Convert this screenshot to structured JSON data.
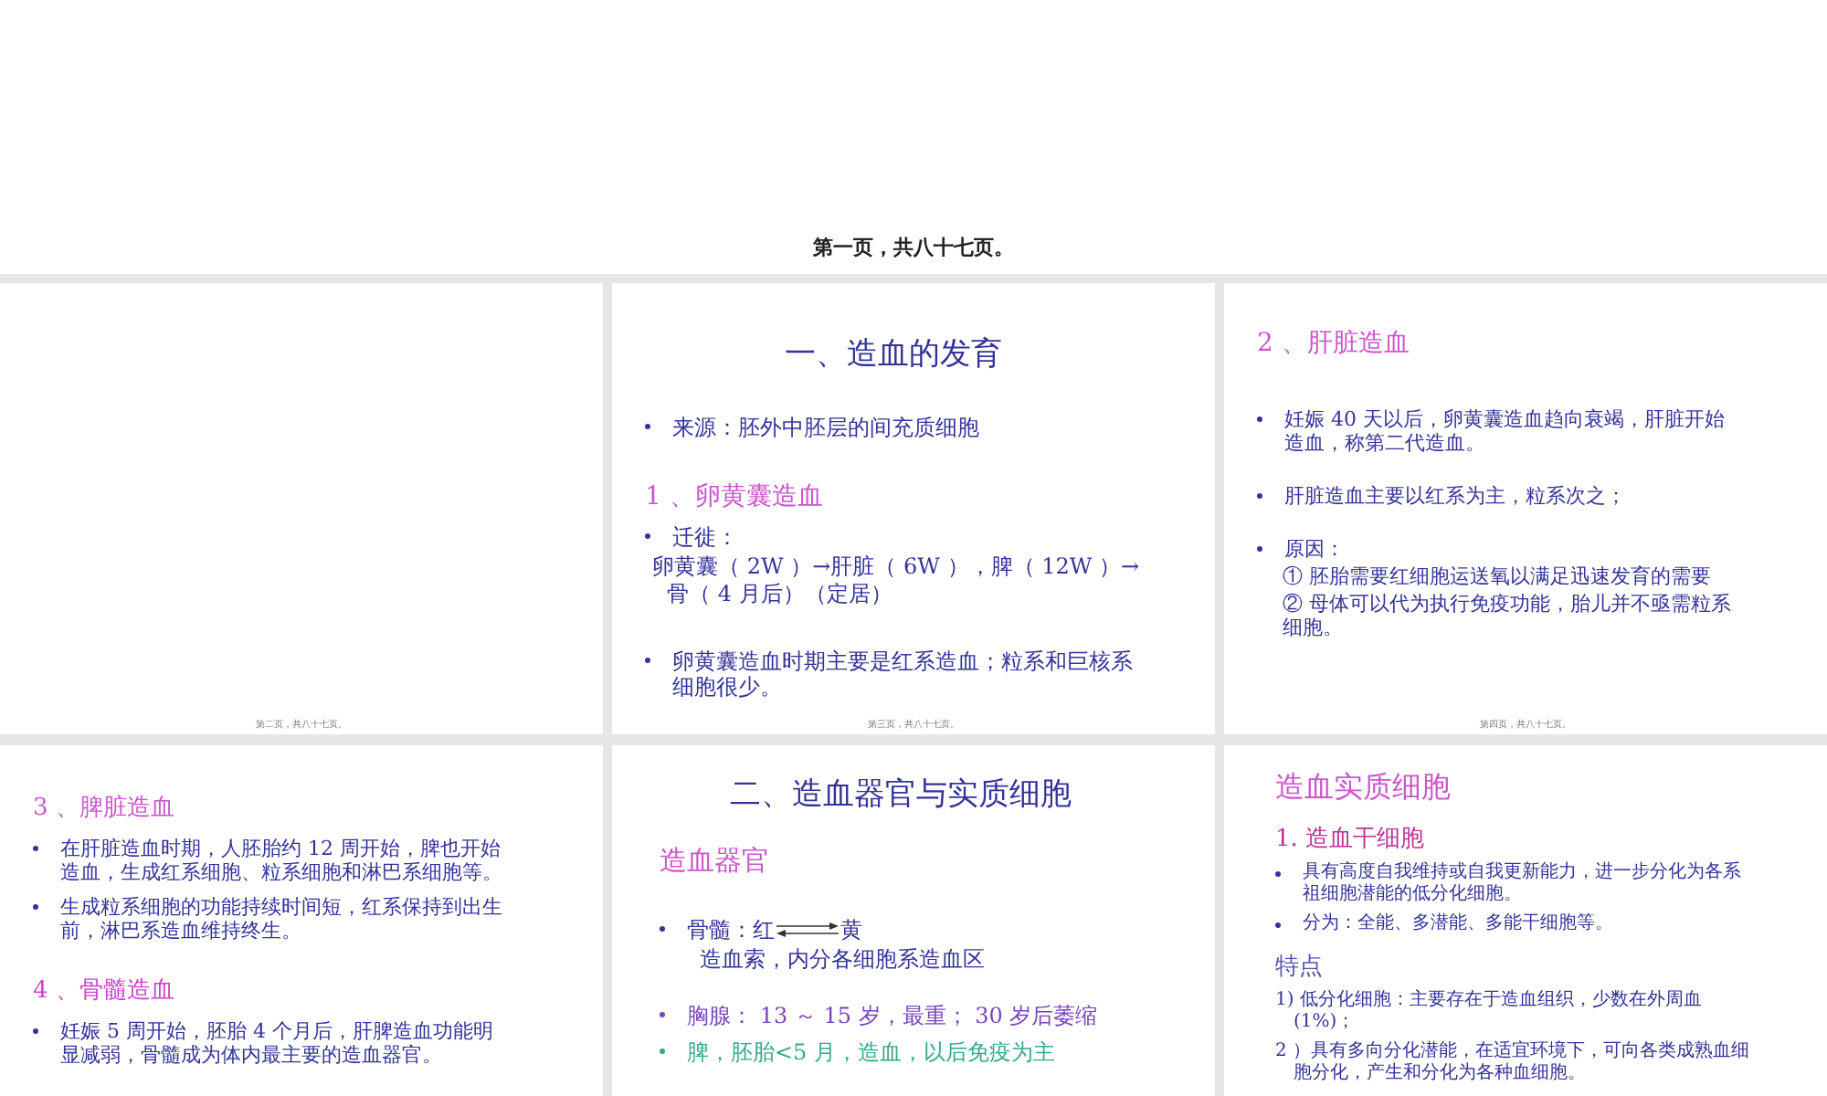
{
  "header": {
    "text": "第一页，共八十七页。"
  },
  "slides": [
    {
      "footer": "第二页，共八十七页。"
    },
    {
      "footer": "第三页，共八十七页。",
      "items": [
        {
          "kind": "title",
          "text": "一、造血的发育",
          "color": "#33339a"
        },
        {
          "kind": "bullet",
          "text": "来源：胚外中胚层的间充质细胞",
          "color": "#33339a"
        },
        {
          "kind": "heading",
          "text": "1 、卵黄囊造血",
          "color": "#cc55cc"
        },
        {
          "kind": "bullet",
          "text": " 迁徙：",
          "color": "#33339a"
        },
        {
          "kind": "text",
          "text": "卵黄囊（ 2W ）→肝脏（ 6W ），脾（ 12W ）→骨（ 4 月后）（定居）",
          "color": "#33339a"
        },
        {
          "kind": "bullet",
          "text": "卵黄囊造血时期主要是红系造血；粒系和巨核系细胞很少。",
          "color": "#33339a"
        }
      ]
    },
    {
      "footer": "第四页，共八十七页。",
      "items": [
        {
          "kind": "heading",
          "text": "2 、肝脏造血",
          "color": "#cc55cc"
        },
        {
          "kind": "bullet",
          "text": "妊娠 40 天以后，卵黄囊造血趋向衰竭，肝脏开始造血，称第二代造血。",
          "color": "#33339a"
        },
        {
          "kind": "bullet",
          "text": "肝脏造血主要以红系为主，粒系次之；",
          "color": "#33339a"
        },
        {
          "kind": "bullet",
          "text": "原因：",
          "color": "#33339a"
        },
        {
          "kind": "subtext",
          "text": "① 胚胎需要红细胞运送氧以满足迅速发育的需要",
          "color": "#33339a"
        },
        {
          "kind": "subtext",
          "text": "② 母体可以代为执行免疫功能，胎儿并不亟需粒系细胞。",
          "color": "#33339a"
        }
      ]
    },
    {
      "items": [
        {
          "kind": "heading",
          "text": "3 、脾脏造血",
          "color": "#cc55cc"
        },
        {
          "kind": "bullet",
          "text": "在肝脏造血时期，人胚胎约 12 周开始，脾也开始造血，生成红系细胞、粒系细胞和淋巴系细胞等。",
          "color": "#33339a"
        },
        {
          "kind": "bullet",
          "text": "生成粒系细胞的功能持续时间短，红系保持到出生前，淋巴系造血维持终生。",
          "color": "#33339a"
        },
        {
          "kind": "heading",
          "text": "4 、骨髓造血",
          "color": "#cc44cc"
        },
        {
          "kind": "bullet",
          "text": "妊娠 5 周开始，胚胎 4 个月后，肝脾造血功能明显减弱，骨髓成为体内最主要的造血器官。",
          "color": "#33339a"
        }
      ]
    },
    {
      "items": [
        {
          "kind": "title",
          "text": "二、造血器官与实质细胞",
          "color": "#33339a"
        },
        {
          "kind": "heading",
          "text": "造血器官",
          "color": "#cc55cc"
        },
        {
          "kind": "arrow",
          "text": "骨髓：红",
          "after": "黄",
          "color": "#33339a"
        },
        {
          "kind": "subtext",
          "text": "造血索，内分各细胞系造血区",
          "color": "#33339a"
        },
        {
          "kind": "bullet",
          "text": "胸腺： 13 ～ 15 岁，最重； 30 岁后萎缩",
          "color": "#7744bb"
        },
        {
          "kind": "bullet",
          "text": "脾，胚胎<5 月，造血，以后免疫为主",
          "color": "#33aa88"
        }
      ]
    },
    {
      "items": [
        {
          "kind": "heading",
          "text": "造血实质细胞",
          "color": "#cc55cc"
        },
        {
          "kind": "subheading",
          "text": "1. 造血干细胞",
          "color": "#bb3399"
        },
        {
          "kind": "bullet",
          "text": "具有高度自我维持或自我更新能力，进一步分化为各系祖细胞潜能的低分化细胞。",
          "color": "#33339a"
        },
        {
          "kind": "bullet",
          "text": "分为：全能、多潜能、多能干细胞等。",
          "color": "#33339a"
        },
        {
          "kind": "subheading",
          "text": "特点",
          "color": "#5555aa"
        },
        {
          "kind": "text",
          "text": "1) 低分化细胞：主要存在于造血组织，少数在外周血 (1%)；",
          "color": "#33339a"
        },
        {
          "kind": "text",
          "text": "2 ）具有多向分化潜能，在适宜环境下，可向各类成熟血细胞分化，产生和分化为各种血细胞。",
          "color": "#33339a"
        }
      ]
    }
  ]
}
